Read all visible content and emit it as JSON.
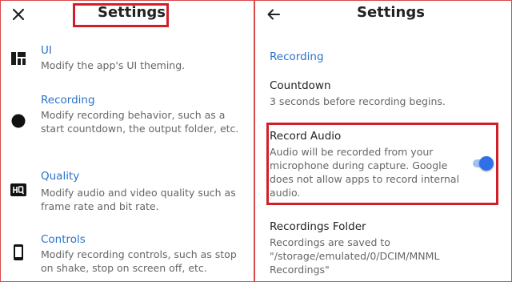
{
  "left": {
    "title": "Settings",
    "items": [
      {
        "title": "UI",
        "desc": "Modify the app's UI theming.",
        "icon": "dashboard-icon"
      },
      {
        "title": "Recording",
        "desc": "Modify recording behavior, such as a start countdown, the output folder, etc.",
        "icon": "record-dot-icon"
      },
      {
        "title": "Quality",
        "desc": "Modify audio and video quality such as frame rate and bit rate.",
        "icon": "hq-icon"
      },
      {
        "title": "Controls",
        "desc": "Modify recording controls, such as stop on shake, stop on screen off, etc.",
        "icon": "phone-icon"
      }
    ]
  },
  "right": {
    "title": "Settings",
    "section": "Recording",
    "settings": [
      {
        "title": "Countdown",
        "desc": "3 seconds before recording begins."
      },
      {
        "title": "Record Audio",
        "desc": "Audio will be recorded from your microphone during capture. Google does not allow apps to record internal audio.",
        "toggle_on": true
      },
      {
        "title": "Recordings Folder",
        "desc": "Recordings are saved to \"/storage/emulated/0/DCIM/MNML Recordings\""
      }
    ]
  },
  "colors": {
    "accent": "#2a73c8",
    "toggle": "#2f6fe8",
    "highlight": "#d11f2a"
  }
}
